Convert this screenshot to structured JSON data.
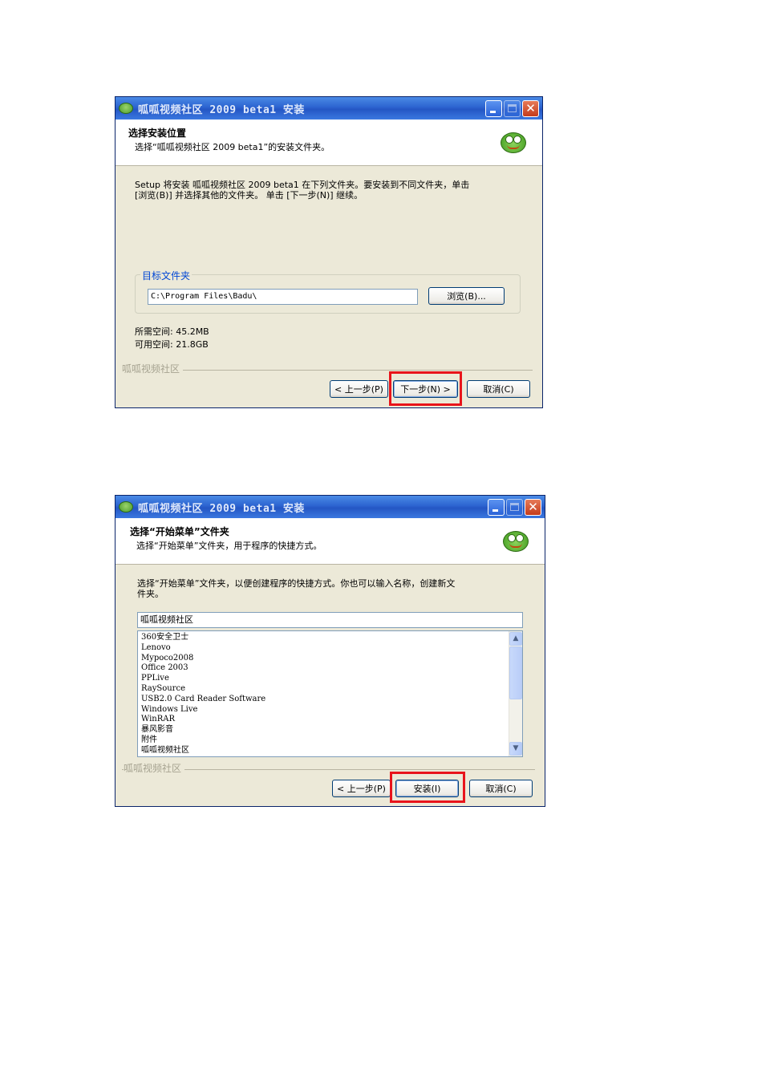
{
  "dialog1": {
    "title": "呱呱视频社区 2009 beta1 安装",
    "header_title": "选择安装位置",
    "header_subtitle": "选择“呱呱视频社区 2009 beta1”的安装文件夹。",
    "description_line1": "Setup 将安装 呱呱视频社区 2009 beta1 在下列文件夹。要安装到不同文件夹，单击",
    "description_line2": "[浏览(B)] 并选择其他的文件夹。 单击 [下一步(N)] 继续。",
    "group_label": "目标文件夹",
    "folder_path": "C:\\Program Files\\Badu\\",
    "browse_label": "浏览(B)...",
    "space_required": "所需空间: 45.2MB",
    "space_available": "可用空间: 21.8GB",
    "brand_text": "呱呱视频社区",
    "back_label": "< 上一步(P)",
    "next_label": "下一步(N) >",
    "cancel_label": "取消(C)"
  },
  "dialog2": {
    "title": "呱呱视频社区 2009 beta1 安装",
    "header_title": "选择“开始菜单”文件夹",
    "header_subtitle": "选择“开始菜单”文件夹，用于程序的快捷方式。",
    "description_line1": "选择“开始菜单”文件夹，以便创建程序的快捷方式。你也可以输入名称，创建新文",
    "description_line2": "件夹。",
    "folder_name": "呱呱视频社区",
    "folders": [
      "360安全卫士",
      "Lenovo",
      "Mypoco2008",
      "Office 2003",
      "PPLive",
      "RaySource",
      "USB2.0 Card Reader Software",
      "Windows Live",
      "WinRAR",
      "暴风影音",
      "附件",
      "呱呱视频社区"
    ],
    "brand_text": "呱呱视频社区",
    "back_label": "< 上一步(P)",
    "install_label": "安装(I)",
    "cancel_label": "取消(C)"
  },
  "colors": {
    "highlight_box": "#e8141b",
    "titlebar": "#2c64d0",
    "dialog_bg": "#ece9d8"
  },
  "icons": {
    "app_icon": "frog-icon",
    "minimize": "minimize-icon",
    "maximize": "maximize-icon",
    "close": "close-icon"
  }
}
